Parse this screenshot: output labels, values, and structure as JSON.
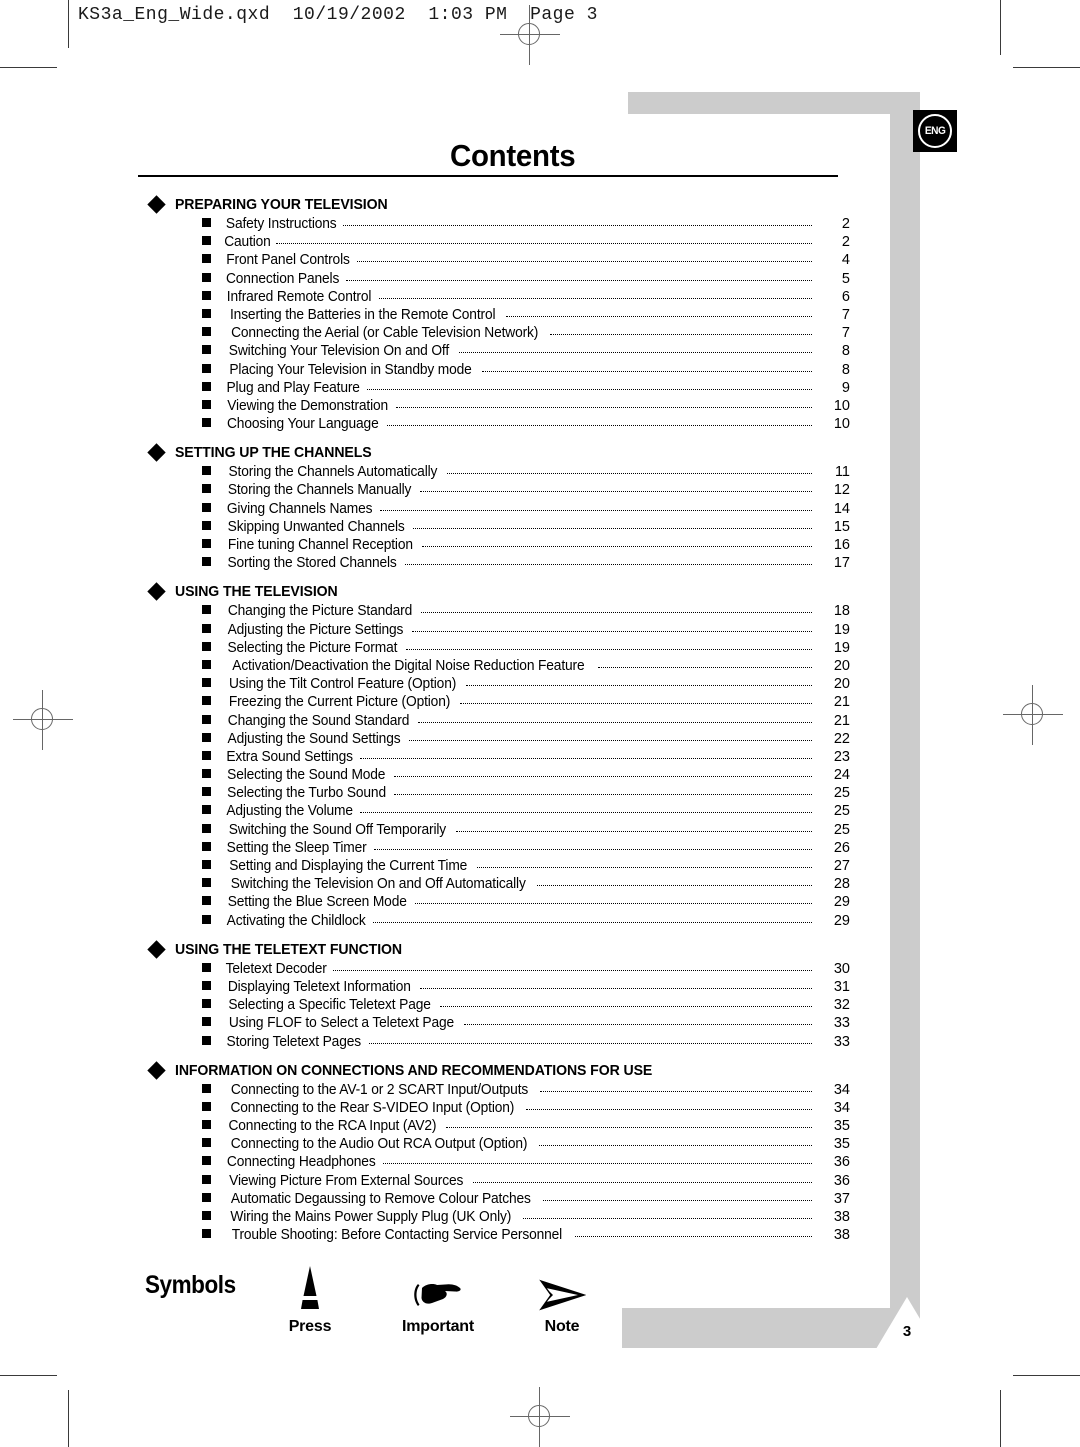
{
  "file_header": "KS3a_Eng_Wide.qxd  10/19/2002  1:03 PM  Page 3",
  "badge": {
    "language_code": "ENG",
    "page_number": "3"
  },
  "title": "Contents",
  "toc": [
    {
      "section": "PREPARING YOUR TELEVISION",
      "entries": [
        {
          "title": "Safety Instructions",
          "page": "2"
        },
        {
          "title": "Caution",
          "page": "2"
        },
        {
          "title": "Front Panel Controls",
          "page": "4"
        },
        {
          "title": "Connection Panels",
          "page": "5"
        },
        {
          "title": "Infrared Remote Control",
          "page": "6"
        },
        {
          "title": "Inserting the Batteries in the Remote Control",
          "page": "7"
        },
        {
          "title": "Connecting the Aerial (or Cable Television Network)",
          "page": "7"
        },
        {
          "title": "Switching Your Television On and Off",
          "page": "8"
        },
        {
          "title": "Placing Your Television in Standby mode",
          "page": "8"
        },
        {
          "title": "Plug and Play Feature",
          "page": "9"
        },
        {
          "title": "Viewing the Demonstration",
          "page": "10"
        },
        {
          "title": "Choosing Your Language",
          "page": "10"
        }
      ]
    },
    {
      "section": "SETTING UP THE CHANNELS",
      "entries": [
        {
          "title": "Storing the Channels Automatically",
          "page": "11"
        },
        {
          "title": "Storing the Channels Manually",
          "page": "12"
        },
        {
          "title": "Giving Channels Names",
          "page": "14"
        },
        {
          "title": "Skipping Unwanted Channels",
          "page": "15"
        },
        {
          "title": "Fine tuning Channel Reception",
          "page": "16"
        },
        {
          "title": "Sorting the Stored Channels",
          "page": "17"
        }
      ]
    },
    {
      "section": "USING THE TELEVISION",
      "entries": [
        {
          "title": "Changing the Picture Standard",
          "page": "18"
        },
        {
          "title": "Adjusting the Picture Settings",
          "page": "19"
        },
        {
          "title": "Selecting the Picture Format",
          "page": "19"
        },
        {
          "title": "Activation/Deactivation the Digital Noise Reduction Feature",
          "page": "20"
        },
        {
          "title": "Using the Tilt Control Feature (Option)",
          "page": "20"
        },
        {
          "title": "Freezing the Current Picture (Option)",
          "page": "21"
        },
        {
          "title": "Changing the Sound Standard",
          "page": "21"
        },
        {
          "title": "Adjusting the Sound Settings",
          "page": "22"
        },
        {
          "title": "Extra Sound Settings",
          "page": "23"
        },
        {
          "title": "Selecting the Sound Mode",
          "page": "24"
        },
        {
          "title": "Selecting the Turbo Sound",
          "page": "25"
        },
        {
          "title": "Adjusting the Volume",
          "page": "25"
        },
        {
          "title": "Switching the Sound Off Temporarily",
          "page": "25"
        },
        {
          "title": "Setting the Sleep Timer",
          "page": "26"
        },
        {
          "title": "Setting and Displaying the Current Time",
          "page": "27"
        },
        {
          "title": "Switching the Television On and Off Automatically",
          "page": "28"
        },
        {
          "title": "Setting the Blue Screen Mode",
          "page": "29"
        },
        {
          "title": "Activating the Childlock",
          "page": "29"
        }
      ]
    },
    {
      "section": "USING THE TELETEXT FUNCTION",
      "entries": [
        {
          "title": "Teletext Decoder",
          "page": "30"
        },
        {
          "title": "Displaying Teletext Information",
          "page": "31"
        },
        {
          "title": "Selecting a Specific Teletext Page",
          "page": "32"
        },
        {
          "title": "Using FLOF to Select a Teletext Page",
          "page": "33"
        },
        {
          "title": "Storing Teletext Pages",
          "page": "33"
        }
      ]
    },
    {
      "section": "INFORMATION ON CONNECTIONS AND RECOMMENDATIONS FOR USE",
      "entries": [
        {
          "title": "Connecting to the AV-1 or 2 SCART Input/Outputs",
          "page": "34"
        },
        {
          "title": "Connecting to the Rear S-VIDEO Input (Option)",
          "page": "34"
        },
        {
          "title": "Connecting to the RCA Input (AV2)",
          "page": "35"
        },
        {
          "title": "Connecting to the Audio Out RCA Output (Option)",
          "page": "35"
        },
        {
          "title": "Connecting Headphones",
          "page": "36"
        },
        {
          "title": "Viewing Picture From External Sources",
          "page": "36"
        },
        {
          "title": "Automatic Degaussing to Remove Colour Patches",
          "page": "37"
        },
        {
          "title": "Wiring the Mains Power Supply Plug (UK Only)",
          "page": "38"
        },
        {
          "title": "Trouble Shooting: Before Contacting Service Personnel",
          "page": "38"
        }
      ]
    }
  ],
  "symbols": {
    "label": "Symbols",
    "items": [
      {
        "icon": "cone-press-icon",
        "caption": "Press"
      },
      {
        "icon": "pointing-hand-icon",
        "caption": "Important"
      },
      {
        "icon": "arrow-note-icon",
        "caption": "Note"
      }
    ]
  },
  "colors": {
    "frame_grey": "#cccccc",
    "ink": "#000000",
    "crop_mark": "#666666"
  }
}
